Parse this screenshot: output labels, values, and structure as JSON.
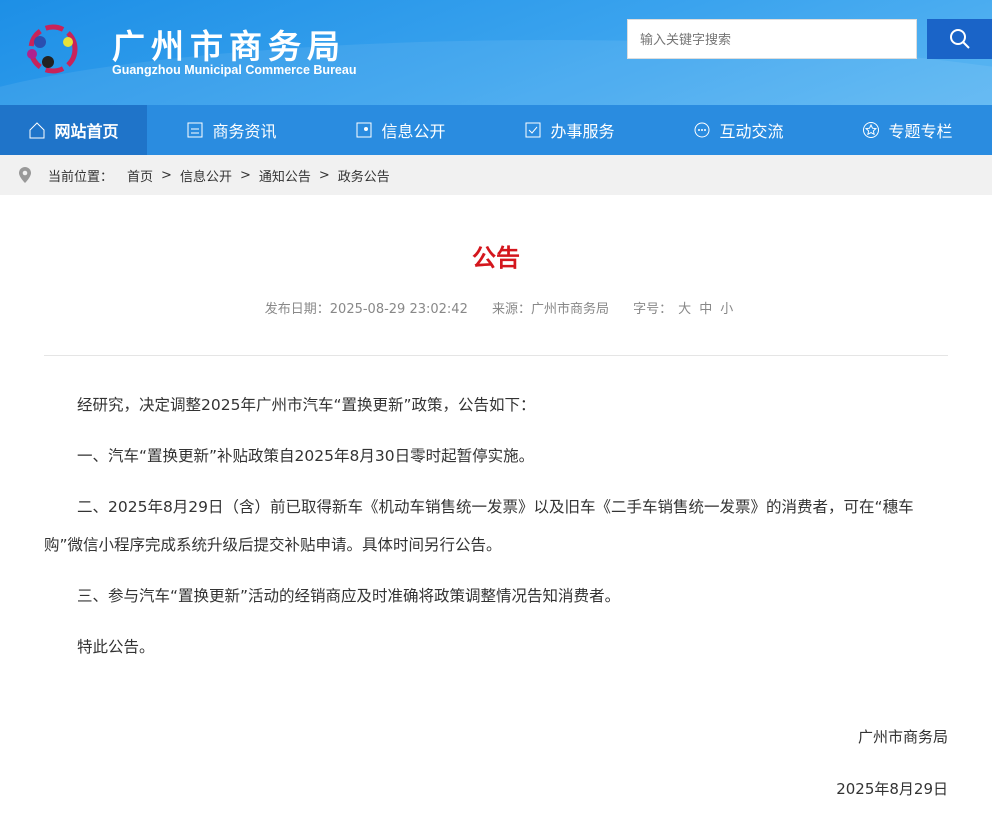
{
  "header": {
    "title_cn": "广州市商务局",
    "title_en": "Guangzhou Municipal Commerce Bureau",
    "search_placeholder": "输入关键字搜索"
  },
  "nav": [
    {
      "label": "网站首页"
    },
    {
      "label": "商务资讯"
    },
    {
      "label": "信息公开"
    },
    {
      "label": "办事服务"
    },
    {
      "label": "互动交流"
    },
    {
      "label": "专题专栏"
    }
  ],
  "breadcrumb": {
    "prefix": "当前位置：",
    "items": [
      "首页",
      "信息公开",
      "通知公告",
      "政务公告"
    ],
    "sep": ">"
  },
  "article": {
    "title": "公告",
    "date_label": "发布日期：2025-08-29 23:02:42",
    "source_label": "来源：广州市商务局",
    "font_label": "字号：",
    "sizes": [
      "大",
      "中",
      "小"
    ],
    "paragraphs": [
      "经研究，决定调整2025年广州市汽车“置换更新”政策，公告如下：",
      "一、汽车“置换更新”补贴政策自2025年8月30日零时起暂停实施。",
      "二、2025年8月29日（含）前已取得新车《机动车销售统一发票》以及旧车《二手车销售统一发票》的消费者，可在“穗车购”微信小程序完成系统升级后提交补贴申请。具体时间另行公告。",
      "三、参与汽车“置换更新”活动的经销商应及时准确将政策调整情况告知消费者。",
      "特此公告。"
    ],
    "signature": "广州市商务局",
    "sign_date": "2025年8月29日"
  }
}
